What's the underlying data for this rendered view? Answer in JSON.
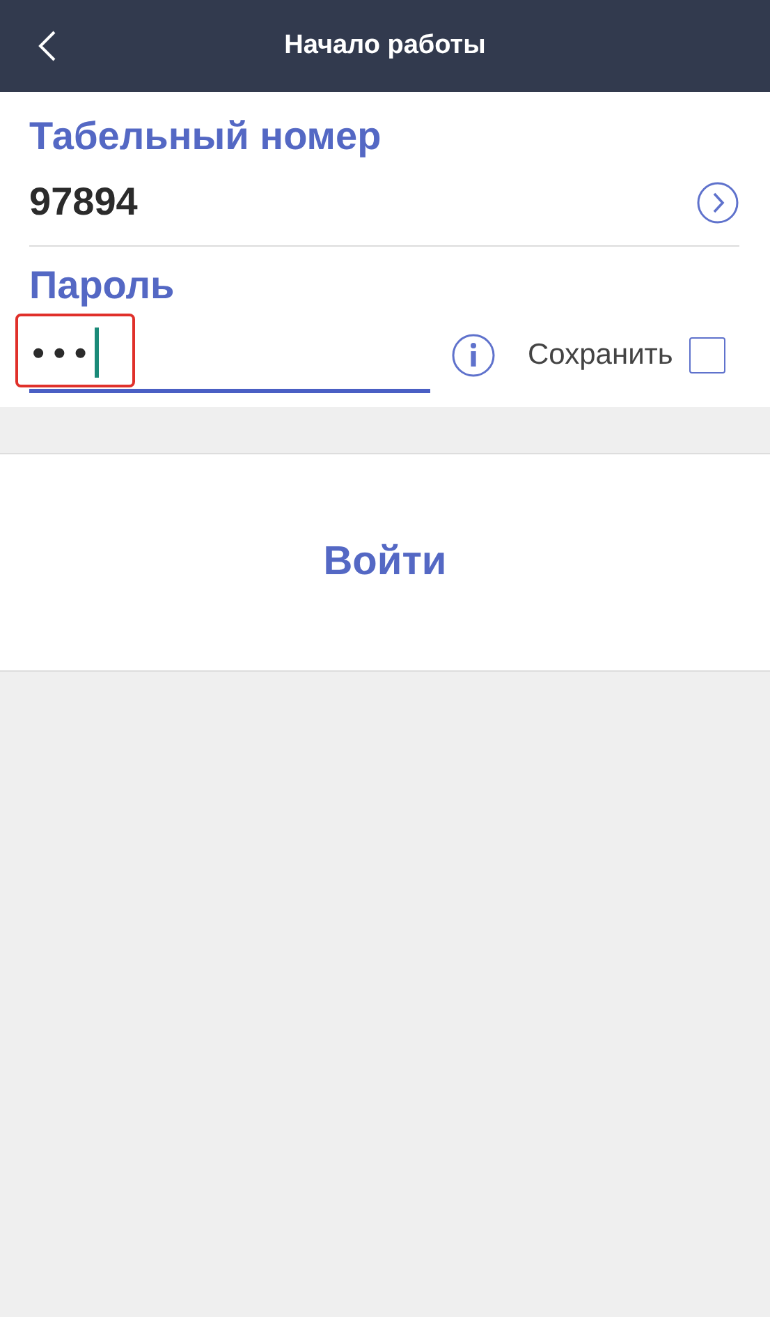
{
  "header": {
    "title": "Начало работы"
  },
  "employee": {
    "label": "Табельный номер",
    "value": "97894"
  },
  "password": {
    "label": "Пароль",
    "value": "•••",
    "focused": true,
    "highlighted": true
  },
  "save": {
    "label": "Сохранить",
    "checked": false
  },
  "login_button": {
    "label": "Войти"
  }
}
